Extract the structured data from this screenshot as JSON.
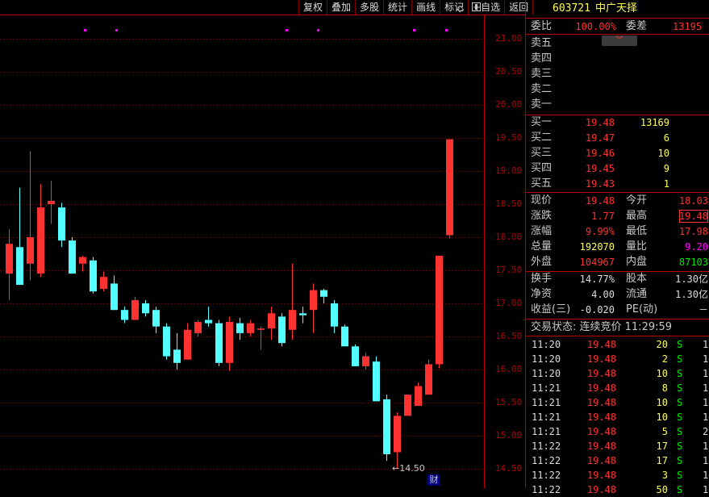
{
  "toolbar": [
    "复权",
    "叠加",
    "多股",
    "统计",
    "画线",
    "标记",
    "+自选",
    "返回"
  ],
  "chart": {
    "price_axis": [
      "21.00",
      "20.50",
      "20.00",
      "19.50",
      "19.00",
      "18.50",
      "18.00",
      "17.50",
      "17.00",
      "16.50",
      "16.00",
      "15.50",
      "15.00",
      "14.50"
    ],
    "low_annotation": "←14.50",
    "finance_badge": "财"
  },
  "chart_data": {
    "type": "candlestick",
    "y_range": [
      14.5,
      21.0
    ],
    "up_color": "#ff3232",
    "down_color": "#54ffff",
    "candles": [
      {
        "o": 17.45,
        "h": 18.12,
        "l": 17.05,
        "c": 17.9
      },
      {
        "o": 17.85,
        "h": 18.75,
        "l": 17.45,
        "c": 17.28
      },
      {
        "o": 17.6,
        "h": 19.3,
        "l": 17.35,
        "c": 18.0
      },
      {
        "o": 17.45,
        "h": 18.8,
        "l": 17.4,
        "c": 18.45
      },
      {
        "o": 18.5,
        "h": 18.85,
        "l": 18.2,
        "c": 18.55
      },
      {
        "o": 18.45,
        "h": 18.52,
        "l": 17.85,
        "c": 17.95
      },
      {
        "o": 17.95,
        "h": 18.0,
        "l": 17.45,
        "c": 17.45
      },
      {
        "o": 17.6,
        "h": 17.72,
        "l": 17.48,
        "c": 17.7
      },
      {
        "o": 17.65,
        "h": 17.7,
        "l": 17.15,
        "c": 17.18
      },
      {
        "o": 17.22,
        "h": 17.48,
        "l": 17.18,
        "c": 17.4
      },
      {
        "o": 17.3,
        "h": 17.42,
        "l": 16.9,
        "c": 16.9
      },
      {
        "o": 16.9,
        "h": 16.95,
        "l": 16.7,
        "c": 16.75
      },
      {
        "o": 16.75,
        "h": 17.1,
        "l": 16.75,
        "c": 17.05
      },
      {
        "o": 17.0,
        "h": 17.05,
        "l": 16.8,
        "c": 16.85
      },
      {
        "o": 16.9,
        "h": 16.95,
        "l": 16.55,
        "c": 16.65
      },
      {
        "o": 16.65,
        "h": 16.7,
        "l": 16.15,
        "c": 16.2
      },
      {
        "o": 16.3,
        "h": 16.55,
        "l": 16.0,
        "c": 16.1
      },
      {
        "o": 16.15,
        "h": 16.7,
        "l": 16.15,
        "c": 16.6
      },
      {
        "o": 16.55,
        "h": 16.75,
        "l": 16.5,
        "c": 16.72
      },
      {
        "o": 16.75,
        "h": 16.95,
        "l": 16.65,
        "c": 16.7
      },
      {
        "o": 16.7,
        "h": 16.75,
        "l": 16.05,
        "c": 16.1
      },
      {
        "o": 16.1,
        "h": 16.8,
        "l": 15.98,
        "c": 16.72
      },
      {
        "o": 16.7,
        "h": 16.78,
        "l": 16.45,
        "c": 16.55
      },
      {
        "o": 16.55,
        "h": 16.75,
        "l": 16.5,
        "c": 16.7
      },
      {
        "o": 16.6,
        "h": 16.65,
        "l": 16.3,
        "c": 16.62
      },
      {
        "o": 16.62,
        "h": 16.95,
        "l": 16.45,
        "c": 16.85
      },
      {
        "o": 16.8,
        "h": 16.85,
        "l": 16.35,
        "c": 16.4
      },
      {
        "o": 16.6,
        "h": 17.6,
        "l": 16.45,
        "c": 16.9
      },
      {
        "o": 16.85,
        "h": 16.95,
        "l": 16.7,
        "c": 16.82
      },
      {
        "o": 16.9,
        "h": 17.3,
        "l": 16.55,
        "c": 17.2
      },
      {
        "o": 17.2,
        "h": 17.22,
        "l": 17.0,
        "c": 17.1
      },
      {
        "o": 17.0,
        "h": 17.05,
        "l": 16.55,
        "c": 16.65
      },
      {
        "o": 16.65,
        "h": 16.68,
        "l": 16.35,
        "c": 16.35
      },
      {
        "o": 16.35,
        "h": 16.38,
        "l": 16.05,
        "c": 16.05
      },
      {
        "o": 16.05,
        "h": 16.25,
        "l": 16.0,
        "c": 16.2
      },
      {
        "o": 16.12,
        "h": 16.2,
        "l": 15.52,
        "c": 15.52
      },
      {
        "o": 15.55,
        "h": 15.62,
        "l": 14.62,
        "c": 14.72
      },
      {
        "o": 14.75,
        "h": 15.35,
        "l": 14.5,
        "c": 15.3
      },
      {
        "o": 15.3,
        "h": 15.62,
        "l": 15.3,
        "c": 15.62
      },
      {
        "o": 15.45,
        "h": 15.8,
        "l": 15.45,
        "c": 15.75
      },
      {
        "o": 15.62,
        "h": 16.15,
        "l": 15.62,
        "c": 16.08
      },
      {
        "o": 16.08,
        "h": 17.72,
        "l": 16.02,
        "c": 17.72
      },
      {
        "o": 18.03,
        "h": 19.48,
        "l": 17.98,
        "c": 19.48
      }
    ],
    "markers_at_top": 6
  },
  "quote": {
    "code": "603721",
    "name": "中广天择",
    "weibi_label": "委比",
    "weibi_value": "100.00%",
    "weicha_label": "委差",
    "weicha_value": "13195",
    "sell": [
      {
        "label": "卖五"
      },
      {
        "label": "卖四"
      },
      {
        "label": "卖三"
      },
      {
        "label": "卖二"
      },
      {
        "label": "卖一"
      }
    ],
    "buy": [
      {
        "label": "买一",
        "price": "19.48",
        "vol": "13169"
      },
      {
        "label": "买二",
        "price": "19.47",
        "vol": "6"
      },
      {
        "label": "买三",
        "price": "19.46",
        "vol": "10"
      },
      {
        "label": "买四",
        "price": "19.45",
        "vol": "9"
      },
      {
        "label": "买五",
        "price": "19.43",
        "vol": "1"
      }
    ],
    "stats_left": [
      {
        "label": "现价",
        "value": "19.48",
        "color": "red"
      },
      {
        "label": "涨跌",
        "value": "1.77",
        "color": "red"
      },
      {
        "label": "涨幅",
        "value": "9.99%",
        "color": "red"
      },
      {
        "label": "总量",
        "value": "192070",
        "color": "yel"
      },
      {
        "label": "外盘",
        "value": "104967",
        "color": "red"
      }
    ],
    "stats_right": [
      {
        "label": "今开",
        "value": "18.03",
        "color": "red"
      },
      {
        "label": "最高",
        "value": "19.48",
        "color": "red"
      },
      {
        "label": "最低",
        "value": "17.98",
        "color": "red"
      },
      {
        "label": "量比",
        "value": "9.20",
        "color": "mag"
      },
      {
        "label": "内盘",
        "value": "87103",
        "color": "grn"
      }
    ],
    "fund_left": [
      {
        "label": "换手",
        "value": "14.77%"
      },
      {
        "label": "净资",
        "value": "4.00"
      },
      {
        "label": "收益(三)",
        "value": "-0.020"
      }
    ],
    "fund_right": [
      {
        "label": "股本",
        "value": "1.30亿"
      },
      {
        "label": "流通",
        "value": "1.30亿"
      },
      {
        "label": "PE(动)",
        "value": "－"
      }
    ],
    "trade_status": "交易状态: 连续竞价 11:29:59",
    "ticks": [
      {
        "time": "11:20",
        "price": "19.48",
        "vol": "20",
        "dir": "S",
        "n": "1"
      },
      {
        "time": "11:20",
        "price": "19.48",
        "vol": "2",
        "dir": "S",
        "n": "1"
      },
      {
        "time": "11:20",
        "price": "19.48",
        "vol": "10",
        "dir": "S",
        "n": "1"
      },
      {
        "time": "11:21",
        "price": "19.48",
        "vol": "8",
        "dir": "S",
        "n": "1"
      },
      {
        "time": "11:21",
        "price": "19.48",
        "vol": "10",
        "dir": "S",
        "n": "1"
      },
      {
        "time": "11:21",
        "price": "19.48",
        "vol": "10",
        "dir": "S",
        "n": "1"
      },
      {
        "time": "11:21",
        "price": "19.48",
        "vol": "5",
        "dir": "S",
        "n": "2"
      },
      {
        "time": "11:22",
        "price": "19.48",
        "vol": "17",
        "dir": "S",
        "n": "1"
      },
      {
        "time": "11:22",
        "price": "19.48",
        "vol": "17",
        "dir": "S",
        "n": "1"
      },
      {
        "time": "11:22",
        "price": "19.48",
        "vol": "3",
        "dir": "S",
        "n": "1"
      },
      {
        "time": "11:22",
        "price": "19.48",
        "vol": "50",
        "dir": "S",
        "n": "1"
      }
    ]
  }
}
